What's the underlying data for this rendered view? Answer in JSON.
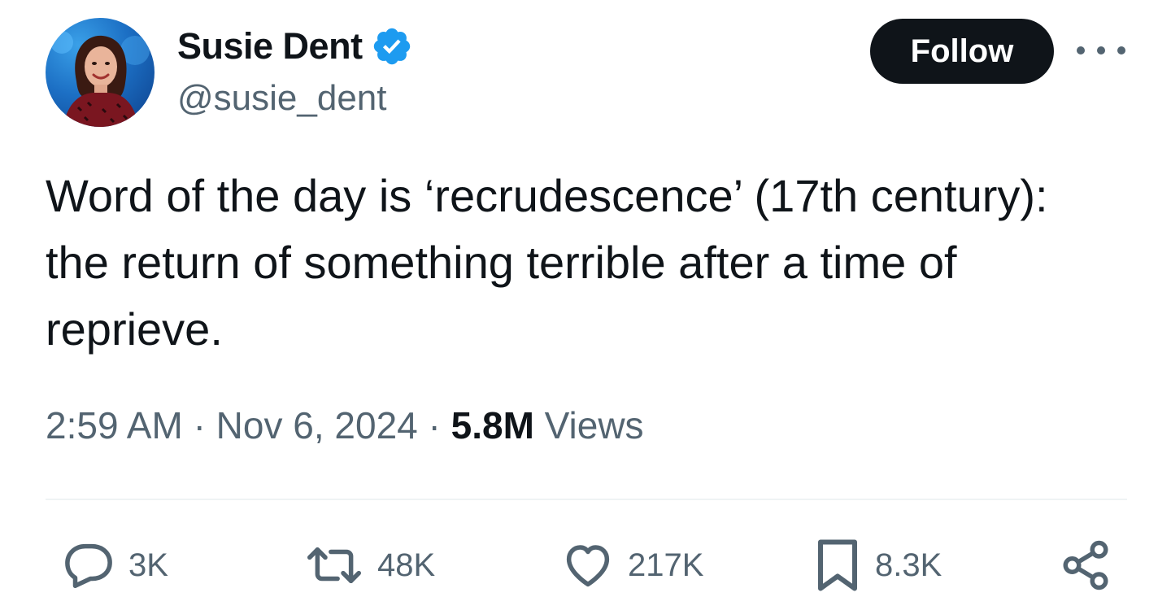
{
  "user": {
    "display_name": "Susie Dent",
    "handle": "@susie_dent",
    "verified": true,
    "verified_color": "#1d9bf0"
  },
  "header": {
    "follow_label": "Follow",
    "more_icon": "more-horizontal-icon"
  },
  "tweet": {
    "text": "Word of the day is ‘recrudescence’ (17th century):\nthe return of something terrible after a time of\nreprieve."
  },
  "meta": {
    "time": "2:59 AM",
    "separator": "·",
    "date": "Nov 6, 2024",
    "views_count": "5.8M",
    "views_label": "Views"
  },
  "actions": {
    "replies": {
      "icon": "reply-icon",
      "count": "3K"
    },
    "reposts": {
      "icon": "repost-icon",
      "count": "48K"
    },
    "likes": {
      "icon": "heart-icon",
      "count": "217K"
    },
    "bookmarks": {
      "icon": "bookmark-icon",
      "count": "8.3K"
    },
    "share": {
      "icon": "share-icon"
    }
  },
  "colors": {
    "text_primary": "#0f1419",
    "text_secondary": "#536471",
    "divider": "#eff3f4",
    "follow_bg": "#0f1419"
  }
}
